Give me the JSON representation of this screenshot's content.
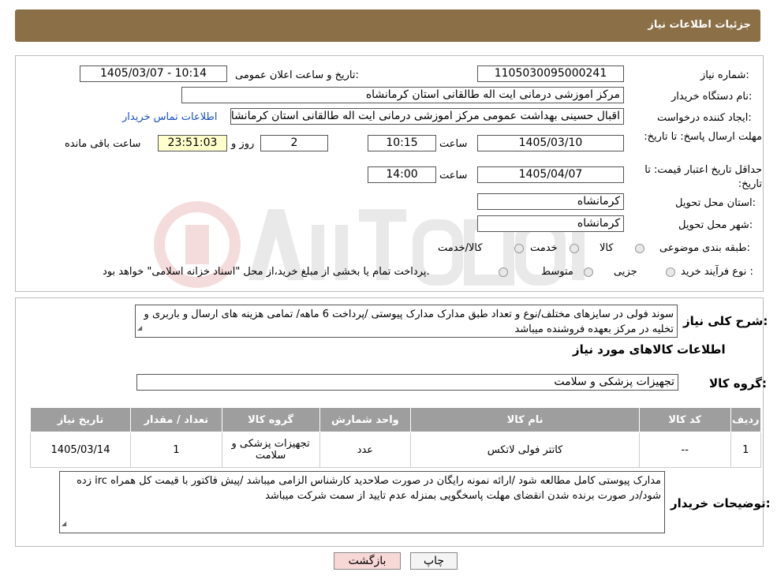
{
  "header": {
    "title": "جزئیات اطلاعات نیاز"
  },
  "form": {
    "need_number_label": "شماره نیاز:",
    "need_number": "1105030095000241",
    "announce_label": "تاریخ و ساعت اعلان عمومی:",
    "announce_value": "1405/03/07 - 10:14",
    "buyer_label": "نام دستگاه خریدار:",
    "buyer": "مرکز اموزشی درمانی ایت اله طالقانی استان کرمانشاه",
    "creator_label": "ایجاد کننده درخواست:",
    "creator": "اقبال حسینی بهداشت عمومی مرکز اموزشی درمانی ایت اله طالقانی استان کرمانشاه",
    "contact_link": "اطلاعات تماس خریدار",
    "deadline_label": "مهلت ارسال پاسخ: تا تاریخ:",
    "deadline_date": "1405/03/10",
    "time_label": "ساعت",
    "deadline_time": "10:15",
    "days_value": "2",
    "days_label": "روز و",
    "remaining_time": "23:51:03",
    "remaining_label": "ساعت باقی مانده",
    "validity_label": "حداقل تاریخ اعتبار قیمت: تا تاریخ:",
    "validity_date": "1405/04/07",
    "validity_time": "14:00",
    "province_label": "استان محل تحویل:",
    "province": "کرمانشاه",
    "city_label": "شهر محل تحویل:",
    "city": "کرمانشاه",
    "category_label": "طبقه بندی موضوعی:",
    "category_options": [
      "کالا",
      "خدمت",
      "کالا/خدمت"
    ],
    "process_label": "نوع فرآیند خرید :",
    "process_options": [
      "جزیی",
      "متوسط"
    ],
    "process_note": "پرداخت تمام یا بخشی از مبلغ خرید،از محل \"اسناد خزانه اسلامی\" خواهد بود."
  },
  "summary": {
    "label": "شرح کلی نیاز:",
    "text": "سوند فولی در سایزهای مختلف/نوع و تعداد طبق مدارک مدارک پیوستی /پرداخت 6 ماهه/ تمامی هزینه های ارسال و باربری و تخلیه در مرکز بعهده فروشنده میباشد"
  },
  "goods": {
    "section_title": "اطلاعات کالاهای مورد نیاز",
    "group_label": "گروه کالا:",
    "group_value": "تجهیزات پزشکی و سلامت",
    "columns": [
      "ردیف",
      "کد کالا",
      "نام کالا",
      "واحد شمارش",
      "گروه کالا",
      "تعداد / مقدار",
      "تاریخ نیاز"
    ],
    "rows": [
      [
        "1",
        "--",
        "کاتتر فولی لاتکس",
        "عدد",
        "تجهیزات پزشکی و سلامت",
        "1",
        "1405/03/14"
      ]
    ]
  },
  "buyer_notes": {
    "label": "توضیحات خریدار:",
    "text": "مدارک پیوستی کامل مطالعه شود /ارائه نمونه رایگان در صورت صلاحدید کارشناس الزامی میباشد /پیش فاکتور با قیمت کل همراه irc  زده شود/در صورت برنده شدن انقضای مهلت پاسخگویی بمنزله عدم تایید از سمت شرکت میباشد"
  },
  "buttons": {
    "print": "چاپ",
    "back": "بازگشت"
  },
  "colors": {
    "header": "#8b6f47",
    "table_header": "#9e9e9e",
    "yellow_field": "#ffffcc",
    "link": "#1a4fc4",
    "back_button": "#f8d7d7"
  }
}
